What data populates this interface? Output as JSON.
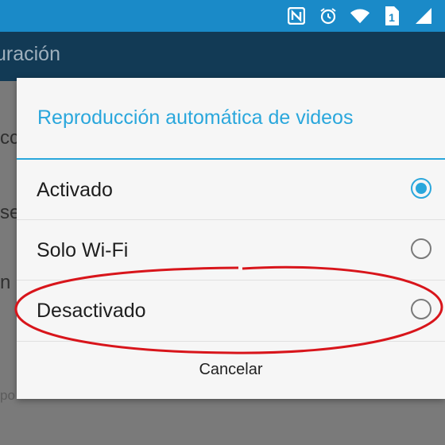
{
  "status_bar": {
    "icons": [
      "nfc-icon",
      "alarm-icon",
      "wifi-icon",
      "sim-1-icon",
      "signal-icon"
    ],
    "sim_label": "1",
    "color": "#1a8ac8"
  },
  "app_bar": {
    "title": "uración"
  },
  "background_list": {
    "items": [
      "cc",
      "se",
      "n a"
    ],
    "sub": "po"
  },
  "dialog": {
    "title": "Reproducción automática de videos",
    "accent_color": "#2aa7dc",
    "options": [
      {
        "label": "Activado",
        "selected": true
      },
      {
        "label": "Solo Wi-Fi",
        "selected": false
      },
      {
        "label": "Desactivado",
        "selected": false
      }
    ],
    "cancel_label": "Cancelar"
  },
  "annotation": {
    "target": "Desactivado",
    "color": "#d8151b"
  }
}
